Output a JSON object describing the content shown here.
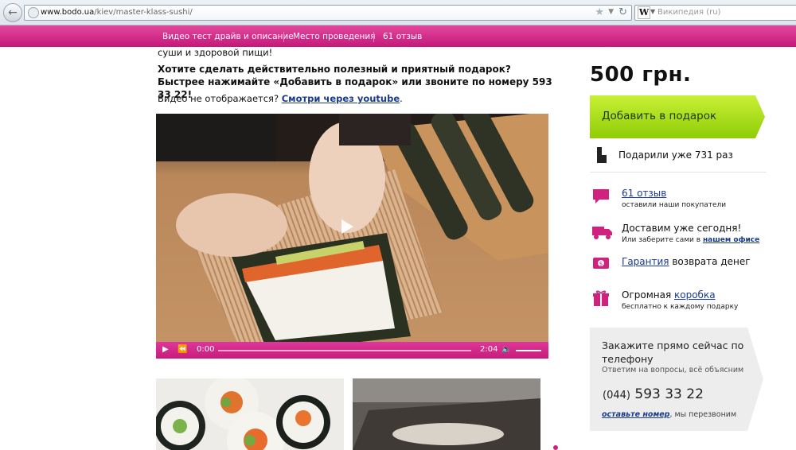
{
  "browser": {
    "url_domain": "www.bodo.ua",
    "url_path": "/kiev/master-klass-sushi/",
    "search_engine": "Википедия (ru)",
    "colors": {
      "chrome": "#dfe5ec"
    }
  },
  "nav": {
    "items": [
      "Видео тест драйв и описание",
      "Место проведения",
      "61 отзыв"
    ],
    "color": "#d02a8a"
  },
  "content": {
    "intro_tail": "суши и здоровой пищи!",
    "question": "Хотите сделать действительно полезный и приятный подарок? Быстрее нажимайте «Добавить в подарок» или звоните по номеру 593 33 22!",
    "novideo_text": "Видео не отображается?",
    "novideo_link": "Смотри через youtube",
    "novideo_dot": "."
  },
  "video": {
    "current_time": "0:00",
    "duration": "2:04",
    "progress": 0,
    "controls_color": "#d02a8a"
  },
  "sidebar": {
    "price": "500 грн.",
    "gift_button": "Добавить в подарок",
    "gifted": "Подарили уже 731 раз",
    "reviews_link": "61 отзыв",
    "reviews_sub": "оставили наши покупатели",
    "delivery_title": "Доставим уже сегодня!",
    "delivery_sub_text": "Или заберите сами в",
    "delivery_sub_link": "нашем офисе",
    "guarantee_link": "Гарантия",
    "guarantee_text": " возврата денег",
    "box_text": "Огромная ",
    "box_link": "коробка",
    "box_sub": "бесплатно к каждому подарку",
    "accent": "#d0217f",
    "button_color": "#9bd60e"
  },
  "phone_box": {
    "title": "Закажите прямо сейчас по телефону",
    "subtitle": "Ответим на вопросы, всё объясним",
    "code": "(044)",
    "number": "593 33 22",
    "leave_link": "оставьте номер",
    "leave_text": ", мы перезвоним"
  }
}
